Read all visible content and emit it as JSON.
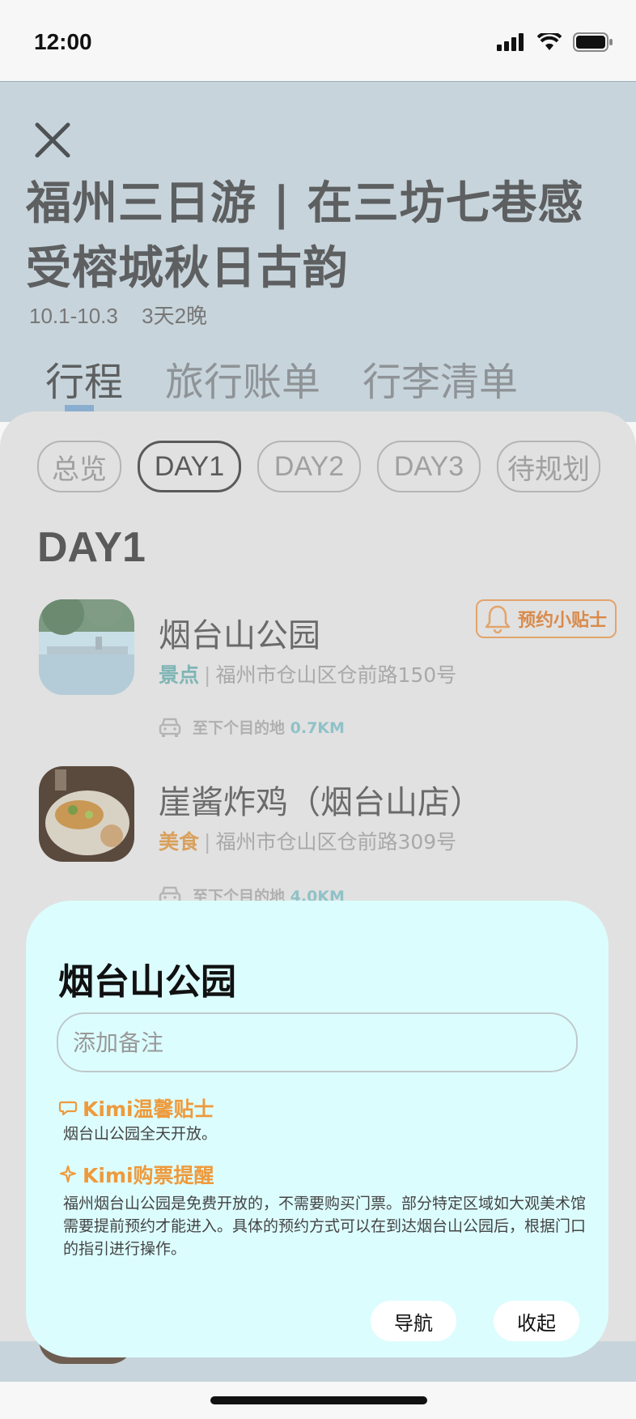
{
  "status": {
    "time": "12:00"
  },
  "header": {
    "title": "福州三日游 | 在三坊七巷感受榕城秋日古韵",
    "dates": "10.1-10.3",
    "duration": "3天2晚",
    "tabs": [
      "行程",
      "旅行账单",
      "行李清单"
    ]
  },
  "days": {
    "chips": [
      "总览",
      "DAY1",
      "DAY2",
      "DAY3",
      "待规划"
    ],
    "active": "DAY1",
    "heading": "DAY1"
  },
  "places": [
    {
      "name": "烟台山公园",
      "category": "景点",
      "address": "福州市仓山区仓前路150号",
      "distance_label": "至下个目的地",
      "distance": "0.7KM"
    },
    {
      "name": "崖酱炸鸡（烟台山店）",
      "category": "美食",
      "address": "福州市仓山区仓前路309号",
      "distance_label": "至下个目的地",
      "distance": "4.0KM"
    }
  ],
  "tip_badge": "预约小贴士",
  "popup": {
    "title": "烟台山公园",
    "note_placeholder": "添加备注",
    "tip1": {
      "title": "Kimi温馨贴士",
      "text": "烟台山公园全天开放。"
    },
    "tip2": {
      "title": "Kimi购票提醒",
      "text": "福州烟台山公园是免费开放的，不需要购买门票。部分特定区域如大观美术馆需要提前预约才能进入。具体的预约方式可以在到达烟台山公园后，根据门口的指引进行操作。"
    },
    "nav_button": "导航",
    "collapse_button": "收起"
  },
  "colors": {
    "hero_bg": "#c7d4db",
    "popup_bg": "#dcfdfe",
    "tip_orange": "#ee9a3c",
    "spot_tag": "#7fb5b5",
    "food_tag": "#d9a05c"
  }
}
